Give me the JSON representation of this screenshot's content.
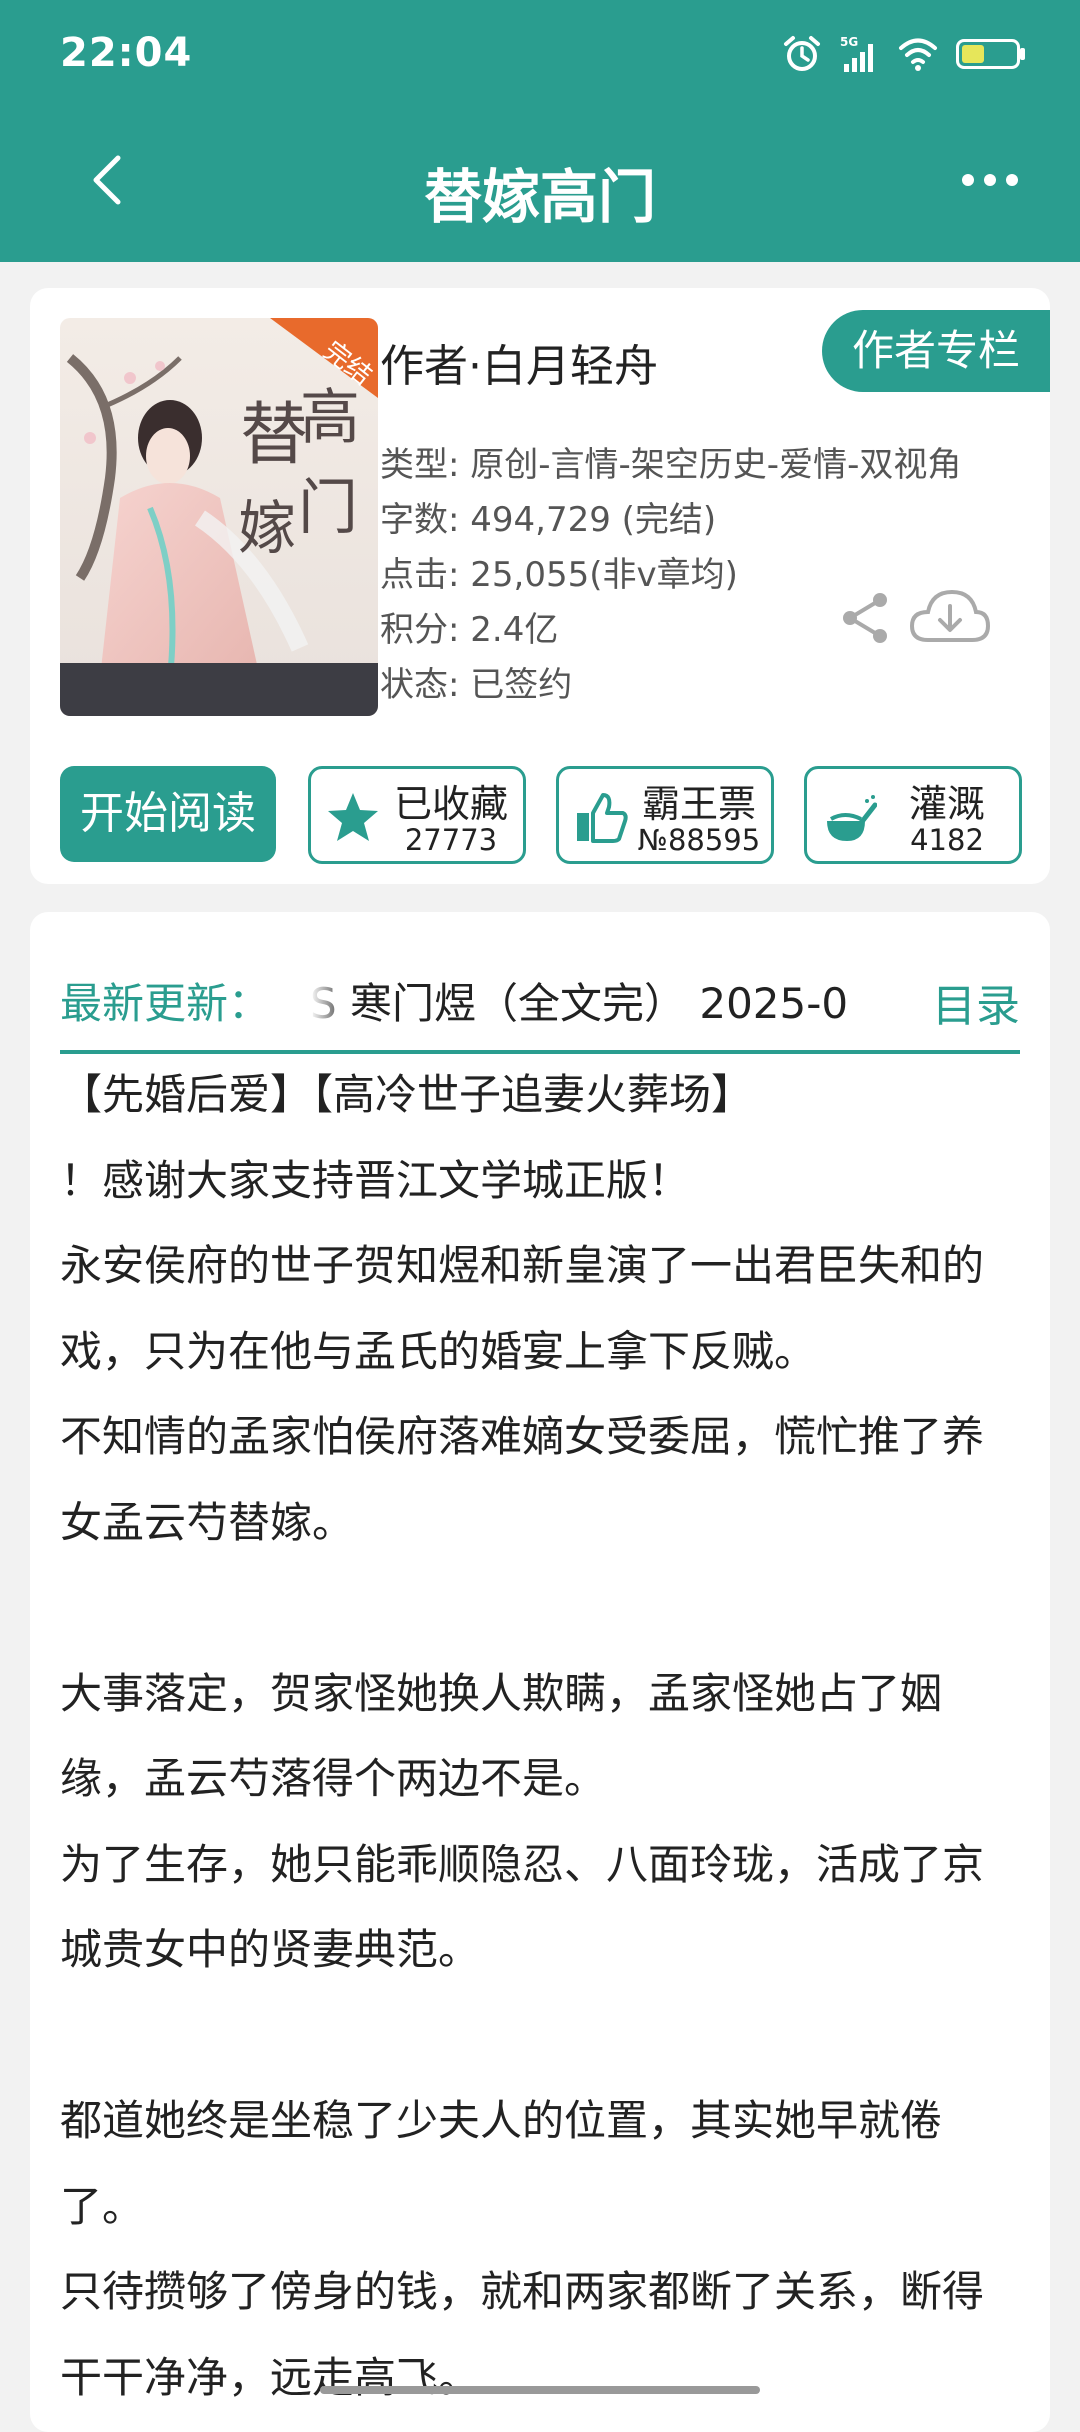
{
  "status_bar": {
    "time": "22:04",
    "network": "5G",
    "icons": [
      "alarm-icon",
      "signal-icon",
      "wifi-icon",
      "battery-icon"
    ]
  },
  "nav": {
    "title": "替嫁高门",
    "back_icon": "chevron-left-icon",
    "more_icon": "more-icon"
  },
  "book": {
    "cover_title_art": "替嫁高门",
    "cover_badge": "完结",
    "author": "作者·白月轻舟",
    "author_tab": "作者专栏",
    "meta": [
      "类型: 原创-言情-架空历史-爱情-双视角",
      "字数: 494,729 (完结)",
      "点击: 25,055(非v章均)",
      "积分: 2.4亿",
      "状态: 已签约"
    ]
  },
  "actions": {
    "read": "开始阅读",
    "stats": [
      {
        "icon": "star-icon",
        "title": "已收藏",
        "value": "27773"
      },
      {
        "icon": "thumbs-up-icon",
        "title": "霸王票",
        "value": "№88595"
      },
      {
        "icon": "watering-can-icon",
        "title": "灌溉",
        "value": "4182"
      }
    ]
  },
  "update": {
    "label": "最新更新：",
    "text": "S 寒门煜（全文完） 2025-0",
    "toc": "目录"
  },
  "description": [
    "【先婚后爱】【高冷世子追妻火葬场】",
    "！感谢大家支持晋江文学城正版！",
    "永安侯府的世子贺知煜和新皇演了一出君臣失和的戏，只为在他与孟氏的婚宴上拿下反贼。",
    "不知情的孟家怕侯府落难嫡女受委屈，慌忙推了养女孟云芍替嫁。",
    "",
    "大事落定，贺家怪她换人欺瞒，孟家怪她占了姻缘，孟云芍落得个两边不是。",
    "为了生存，她只能乖顺隐忍、八面玲珑，活成了京城贵女中的贤妻典范。",
    "",
    "都道她终是坐稳了少夫人的位置，其实她早就倦了。",
    "只待攒够了傍身的钱，就和两家都断了关系，断得干干净净，远走高飞。"
  ],
  "colors": {
    "accent": "#2a9d8f",
    "background": "#f2f2f2",
    "card": "#ffffff"
  }
}
